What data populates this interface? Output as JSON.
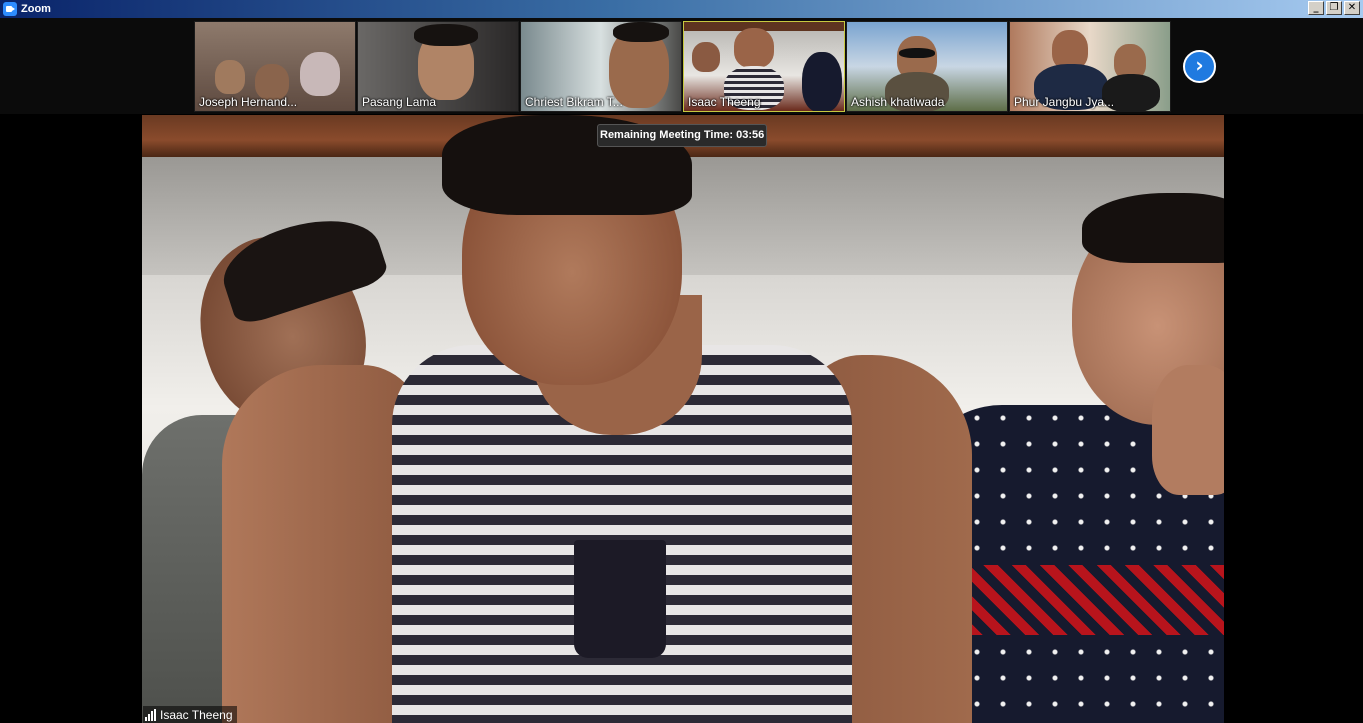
{
  "window": {
    "title": "Zoom",
    "icon": "zoom-camera-icon"
  },
  "window_controls": {
    "minimize": "_",
    "restore": "❐",
    "close": "✕"
  },
  "thumbnails": [
    {
      "name": "Joseph Hernand...",
      "bg": "#7e6a5e"
    },
    {
      "name": "Pasang Lama",
      "bg": "#3a3838"
    },
    {
      "name": "Chriest Bikram T...",
      "bg": "#5e6e72"
    },
    {
      "name": "Isaac Theeng",
      "bg": "#8a8a86",
      "active": true
    },
    {
      "name": "Ashish khatiwada",
      "bg": "#7e98b8"
    },
    {
      "name": "Phur Jangbu Jya...",
      "bg": "#9a8a7e"
    }
  ],
  "next_page_icon": "›",
  "timer": {
    "text": "Remaining Meeting Time: 03:56"
  },
  "active_speaker": {
    "name": "Isaac Theeng"
  }
}
